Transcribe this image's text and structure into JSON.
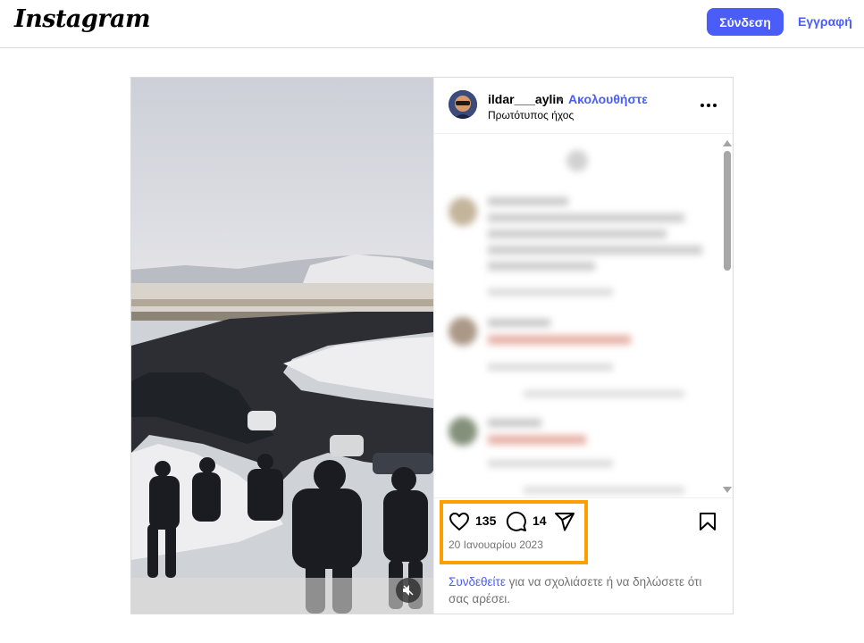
{
  "header": {
    "logo_text": "Instagram",
    "login_label": "Σύνδεση",
    "signup_label": "Εγγραφή",
    "accent_color": "#4a5df9"
  },
  "post": {
    "username": "ildar___aylin",
    "separator": "•",
    "follow_label": "Ακολουθήστε",
    "audio_label": "Πρωτότυπος ήχος",
    "likes": "135",
    "comments": "14",
    "date": "20 Ιανουαρίου 2023",
    "highlight_color": "#ff9e00",
    "video_muted": true,
    "login_prompt": {
      "link_text": "Συνδεθείτε",
      "part1": " για να σχολιάσετε ",
      "or_text": "ή",
      "part2": " να δηλώσετε ότι σας αρέσει."
    }
  },
  "icons": [
    "more-icon",
    "heart-icon",
    "comment-icon",
    "share-icon",
    "bookmark-icon",
    "mute-icon"
  ]
}
